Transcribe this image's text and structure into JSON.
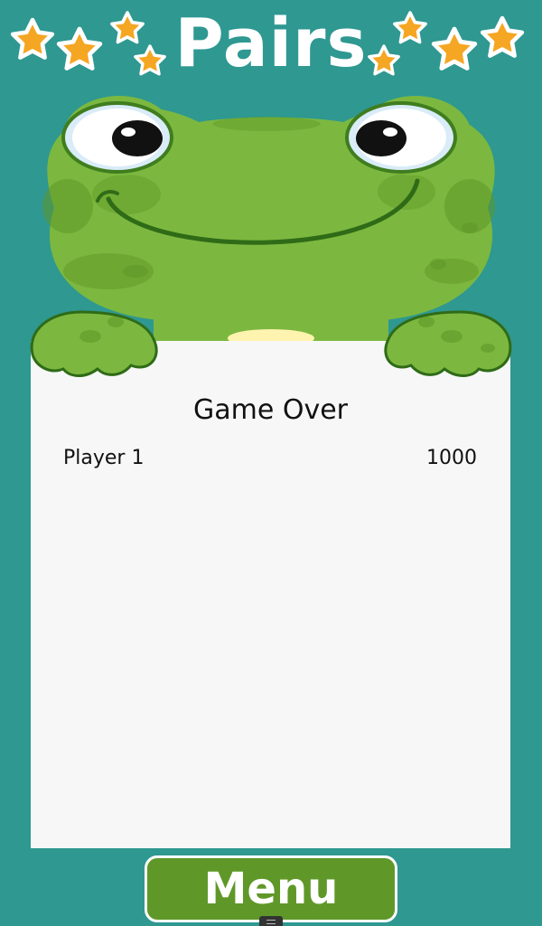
{
  "header": {
    "title": "Pairs"
  },
  "results": {
    "heading": "Game Over",
    "players": [
      {
        "name": "Player 1",
        "score": "1000"
      }
    ]
  },
  "footer": {
    "menu_label": "Menu"
  },
  "colors": {
    "background": "#2e9891",
    "board": "#f7f7f7",
    "menu_button": "#5f9828",
    "frog_green": "#7cb83f",
    "star": "#f5a623"
  }
}
